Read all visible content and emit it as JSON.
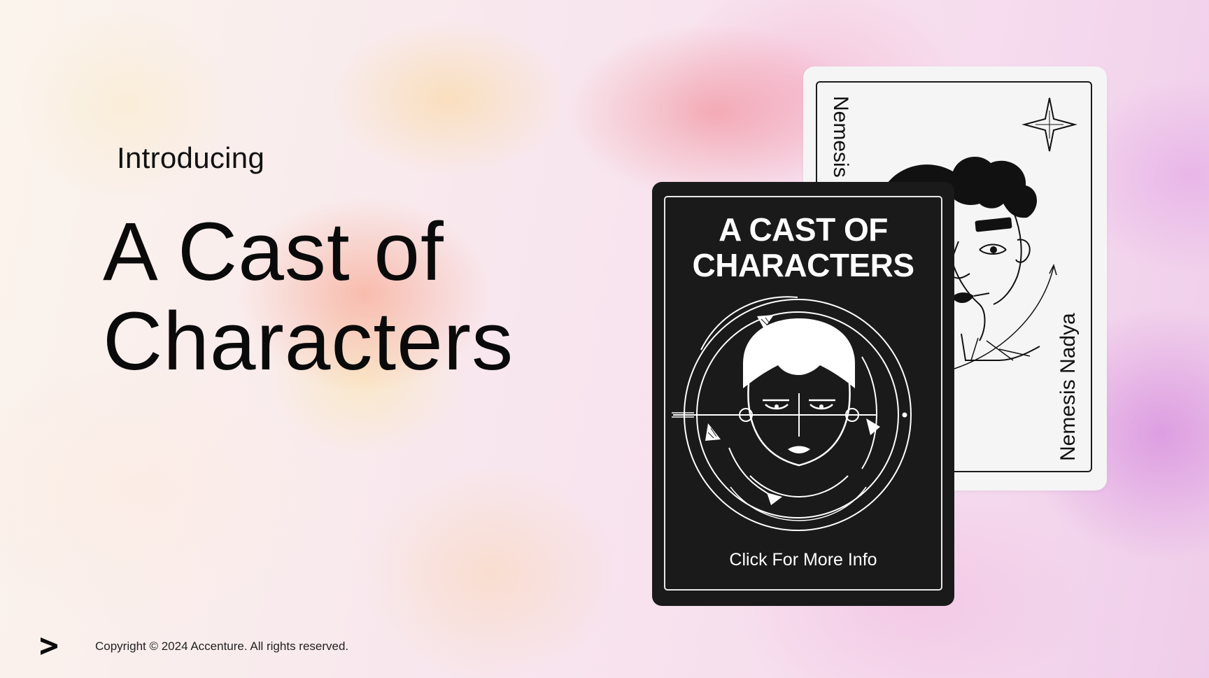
{
  "slide": {
    "eyebrow": "Introducing",
    "title_line1": "A Cast of",
    "title_line2": "Characters"
  },
  "cards": {
    "front": {
      "title_line1": "A CAST OF",
      "title_line2": "CHARACTERS",
      "cta": "Click For More Info",
      "background": "#1a1a1a",
      "foreground": "#ffffff"
    },
    "back": {
      "name_top": "Nemesis Nadya",
      "name_bottom": "Nemesis Nadya",
      "background": "#f5f5f5",
      "foreground": "#111111"
    }
  },
  "footer": {
    "logo": "accenture-chevron-icon",
    "copyright": "Copyright © 2024 Accenture. All rights reserved."
  }
}
